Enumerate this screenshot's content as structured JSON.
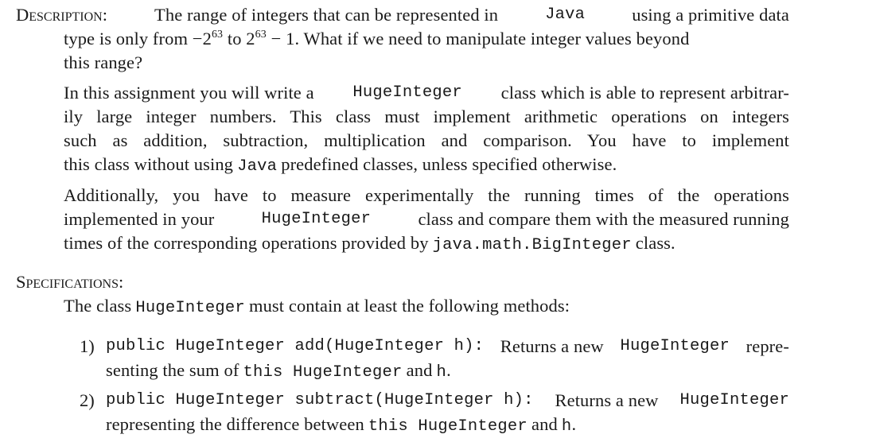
{
  "description": {
    "heading": "Description:",
    "para1": {
      "line1_text": "The range of integers that can be represented in",
      "line1_code": "Java",
      "line1_tail": "using a primitive data",
      "line2_a": "type is only from −2",
      "line2_sup1": "63",
      "line2_b": " to 2",
      "line2_sup2": "63",
      "line2_c": " − 1. What if we need to manipulate integer values beyond",
      "line3": "this range?"
    },
    "para2": {
      "line1_a": "In this assignment you will write a",
      "line1_code": "HugeInteger",
      "line1_b": "class which is able to represent arbitrar-",
      "line2": "ily large integer numbers. This class must implement arithmetic operations on integers",
      "line3": "such as addition, subtraction, multiplication and comparison. You have to implement",
      "line4_a": "this class without using",
      "line4_code": "Java",
      "line4_b": "predefined classes, unless specified otherwise."
    },
    "para3": {
      "line1": "Additionally, you have to measure experimentally the running times of the operations",
      "line2_a": "implemented in your",
      "line2_code": "HugeInteger",
      "line2_b": "class and compare them with the measured running",
      "line3_a": "times of the corresponding operations provided by",
      "line3_code": "java.math.BigInteger",
      "line3_b": "class."
    }
  },
  "specifications": {
    "heading": "Specifications:",
    "intro_a": "The class",
    "intro_code": "HugeInteger",
    "intro_b": "must contain at least the following methods:",
    "items": [
      {
        "number": "1)",
        "signature": "public HugeInteger add(HugeInteger h):",
        "line1_text": "Returns a new",
        "line1_code": "HugeInteger",
        "line1_tail": "repre-",
        "line2_a": "senting the sum of",
        "line2_code1": "this HugeInteger",
        "line2_b": "and",
        "line2_code2": "h",
        "line2_end": "."
      },
      {
        "number": "2)",
        "signature": "public HugeInteger subtract(HugeInteger h):",
        "line1_text": "Returns a new",
        "line1_code": "HugeInteger",
        "line1_tail": "",
        "line2_a": "representing the difference between",
        "line2_code1": "this HugeInteger",
        "line2_b": "and",
        "line2_code2": "h",
        "line2_end": "."
      }
    ]
  }
}
